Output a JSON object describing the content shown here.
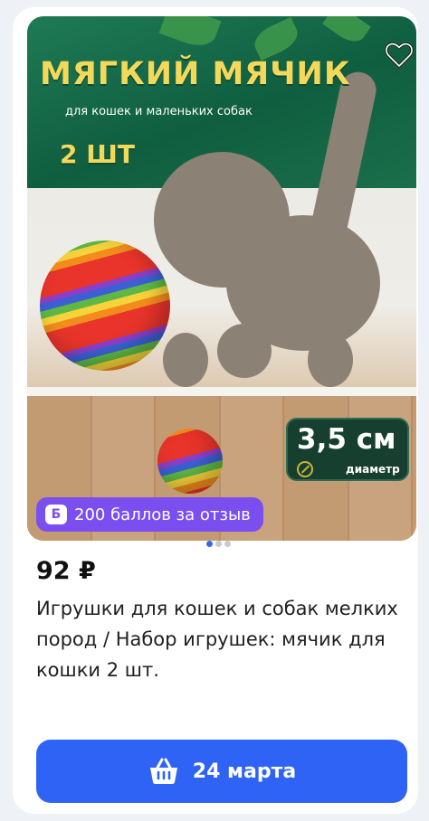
{
  "product": {
    "image_text": {
      "title": "МЯГКИЙ МЯЧИК",
      "subtitle": "для кошек и маленьких собак",
      "pack": "2 ШТ",
      "size_value": "3,5 см",
      "size_label": "диаметр"
    },
    "points_badge": {
      "icon": "Б",
      "text": "200 баллов за отзыв"
    },
    "gallery": {
      "total": 3,
      "active_index": 0
    },
    "price": "92 ₽",
    "title": "Игрушки для кошек и собак мелких пород / Набор игрушек: мячик для кошки 2 шт.",
    "cart_button": {
      "label": "24 марта"
    },
    "favorite_icon": "heart-outline-icon"
  },
  "colors": {
    "accent": "#2f63f5",
    "points_badge": "#7b4ef0",
    "banner_green": "#1b6f4a",
    "banner_text": "#f4d85a"
  }
}
